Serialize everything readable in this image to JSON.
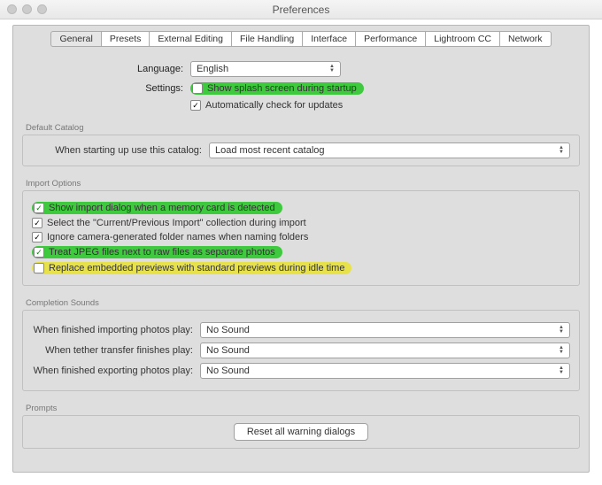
{
  "window": {
    "title": "Preferences"
  },
  "tabs": [
    "General",
    "Presets",
    "External Editing",
    "File Handling",
    "Interface",
    "Performance",
    "Lightroom CC",
    "Network"
  ],
  "active_tab": 0,
  "general": {
    "language_label": "Language:",
    "language_value": "English",
    "settings_label": "Settings:",
    "splash_label": "Show splash screen during startup",
    "updates_label": "Automatically check for updates"
  },
  "catalog": {
    "section": "Default Catalog",
    "label": "When starting up use this catalog:",
    "value": "Load most recent catalog"
  },
  "import": {
    "section": "Import Options",
    "opt1": "Show import dialog when a memory card is detected",
    "opt2": "Select the \"Current/Previous Import\" collection during import",
    "opt3": "Ignore camera-generated folder names when naming folders",
    "opt4": "Treat JPEG files next to raw files as separate photos",
    "opt5": "Replace embedded previews with standard previews during idle time"
  },
  "sounds": {
    "section": "Completion Sounds",
    "import_label": "When finished importing photos play:",
    "tether_label": "When tether transfer finishes play:",
    "export_label": "When finished exporting photos play:",
    "import_value": "No Sound",
    "tether_value": "No Sound",
    "export_value": "No Sound"
  },
  "prompts": {
    "section": "Prompts",
    "reset_label": "Reset all warning dialogs"
  }
}
